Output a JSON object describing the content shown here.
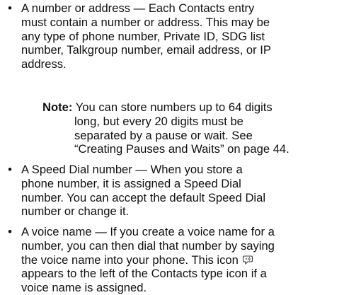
{
  "bullets": [
    {
      "bullet_char": "•",
      "lines": [
        "A number or address — Each Contacts entry",
        "must contain a number or address. This may be",
        "any type of phone number, Private ID, SDG list",
        "number, Talkgroup number, email address, or IP",
        "address."
      ]
    },
    {
      "bullet_char": "•",
      "lines": [
        "A Speed Dial number — When you store a",
        "phone number, it is assigned a Speed Dial",
        "number. You can accept the default Speed Dial",
        "number or change it."
      ]
    },
    {
      "bullet_char": "•",
      "lines": [
        "A voice name — If you create a voice name for a",
        "number, you can then dial that number by saying",
        "the voice name into your phone. This icon",
        "appears to the left of the Contacts type icon if a",
        "voice name is assigned."
      ],
      "icon_name": "voice-name-icon"
    }
  ],
  "note": {
    "label": "Note:",
    "first_line": "You can store numbers up to 64 digits",
    "lines": [
      "long, but every 20 digits must be",
      "separated by a pause or wait. See",
      "“Creating Pauses and Waits” on page 44."
    ]
  }
}
